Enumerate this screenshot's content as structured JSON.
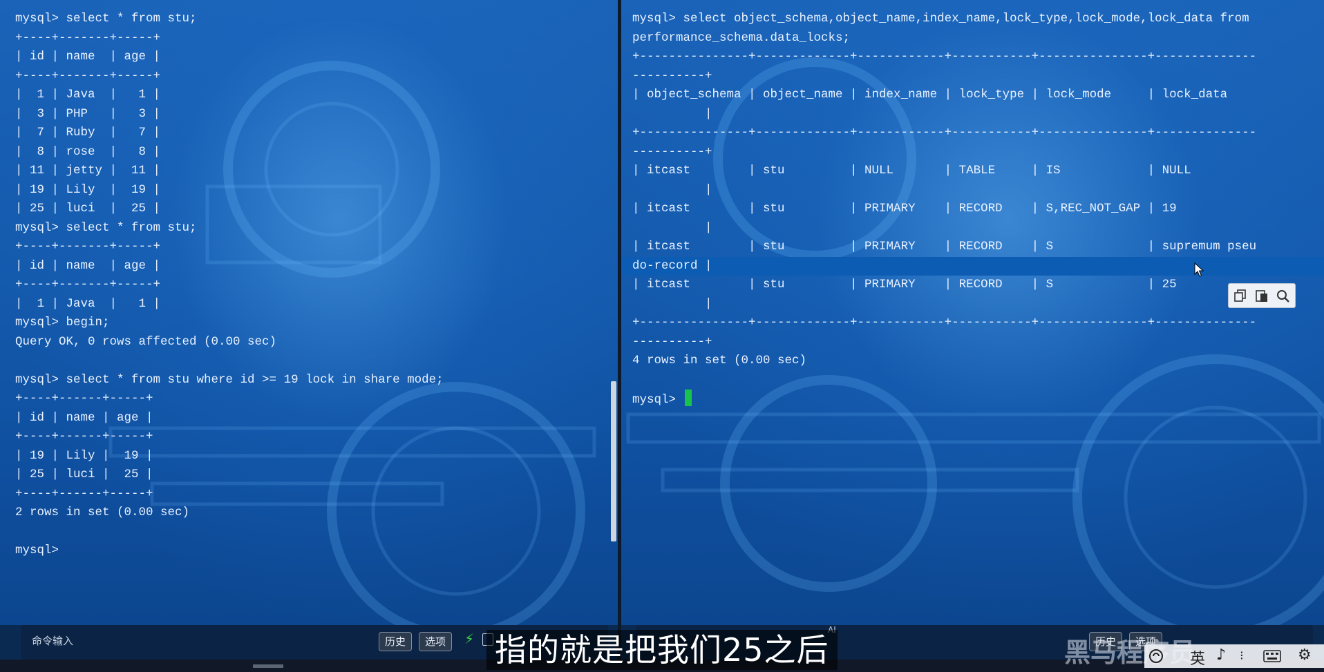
{
  "left_terminal": {
    "lines": [
      "mysql> select * from stu;",
      "+----+-------+-----+",
      "| id | name  | age |",
      "+----+-------+-----+",
      "|  1 | Java  |   1 |",
      "|  3 | PHP   |   3 |",
      "|  7 | Ruby  |   7 |",
      "|  8 | rose  |   8 |",
      "| 11 | jetty |  11 |",
      "| 19 | Lily  |  19 |",
      "| 25 | luci  |  25 |",
      "mysql> select * from stu;",
      "+----+-------+-----+",
      "| id | name  | age |",
      "+----+-------+-----+",
      "|  1 | Java  |   1 |",
      "mysql> begin;",
      "Query OK, 0 rows affected (0.00 sec)",
      "",
      "mysql> select * from stu where id >= 19 lock in share mode;",
      "+----+------+-----+",
      "| id | name | age |",
      "+----+------+-----+",
      "| 19 | Lily |  19 |",
      "| 25 | luci |  25 |",
      "+----+------+-----+",
      "2 rows in set (0.00 sec)",
      "",
      "mysql>"
    ],
    "command_input_label": "命令输入",
    "history_button": "历史",
    "options_button": "选项"
  },
  "right_terminal": {
    "lines": [
      "mysql> select object_schema,object_name,index_name,lock_type,lock_mode,lock_data from",
      "performance_schema.data_locks;",
      "+---------------+-------------+------------+-----------+---------------+--------------",
      "----------+",
      "| object_schema | object_name | index_name | lock_type | lock_mode     | lock_data",
      "          |",
      "+---------------+-------------+------------+-----------+---------------+--------------",
      "----------+",
      "| itcast        | stu         | NULL       | TABLE     | IS            | NULL",
      "          |",
      "| itcast        | stu         | PRIMARY    | RECORD    | S,REC_NOT_GAP | 19",
      "          |",
      "| itcast        | stu         | PRIMARY    | RECORD    | S             | supremum pseu",
      "do-record |",
      "| itcast        | stu         | PRIMARY    | RECORD    | S             | 25",
      "          |",
      "+---------------+-------------+------------+-----------+---------------+--------------",
      "----------+",
      "4 rows in set (0.00 sec)",
      "",
      "mysql> "
    ],
    "highlighted_line_index": 13,
    "history_button": "历史",
    "options_button": "选项"
  },
  "subtitle": "指的就是把我们25之后",
  "ai_mark": "AI",
  "watermark": "黑马程序员",
  "ime": {
    "lang": "英"
  },
  "colors": {
    "cursor": "#19c24a",
    "text": "#e8f1ff",
    "background": "#145aad"
  }
}
